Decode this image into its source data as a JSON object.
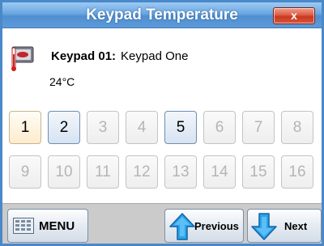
{
  "window": {
    "title": "Keypad Temperature",
    "close_label": "x",
    "title_gradient_color": "#5d9ad8",
    "close_color": "#d8553c"
  },
  "keypad": {
    "label": "Keypad 01",
    "separator": ":",
    "description": "Keypad One",
    "temperature": "24°C"
  },
  "keypad_buttons": [
    {
      "label": "1",
      "state": "selected"
    },
    {
      "label": "2",
      "state": "active"
    },
    {
      "label": "3",
      "state": "disabled"
    },
    {
      "label": "4",
      "state": "disabled"
    },
    {
      "label": "5",
      "state": "active"
    },
    {
      "label": "6",
      "state": "disabled"
    },
    {
      "label": "7",
      "state": "disabled"
    },
    {
      "label": "8",
      "state": "disabled"
    },
    {
      "label": "9",
      "state": "disabled"
    },
    {
      "label": "10",
      "state": "disabled"
    },
    {
      "label": "11",
      "state": "disabled"
    },
    {
      "label": "12",
      "state": "disabled"
    },
    {
      "label": "13",
      "state": "disabled"
    },
    {
      "label": "14",
      "state": "disabled"
    },
    {
      "label": "15",
      "state": "disabled"
    },
    {
      "label": "16",
      "state": "disabled"
    }
  ],
  "bottom": {
    "menu_label": "MENU",
    "previous_label": "Previous",
    "next_label": "Next"
  },
  "icons": {
    "keypad": "thermometer-keypad-icon",
    "menu": "keypad-grid-icon",
    "previous": "up-arrow-icon",
    "next": "down-arrow-icon"
  }
}
